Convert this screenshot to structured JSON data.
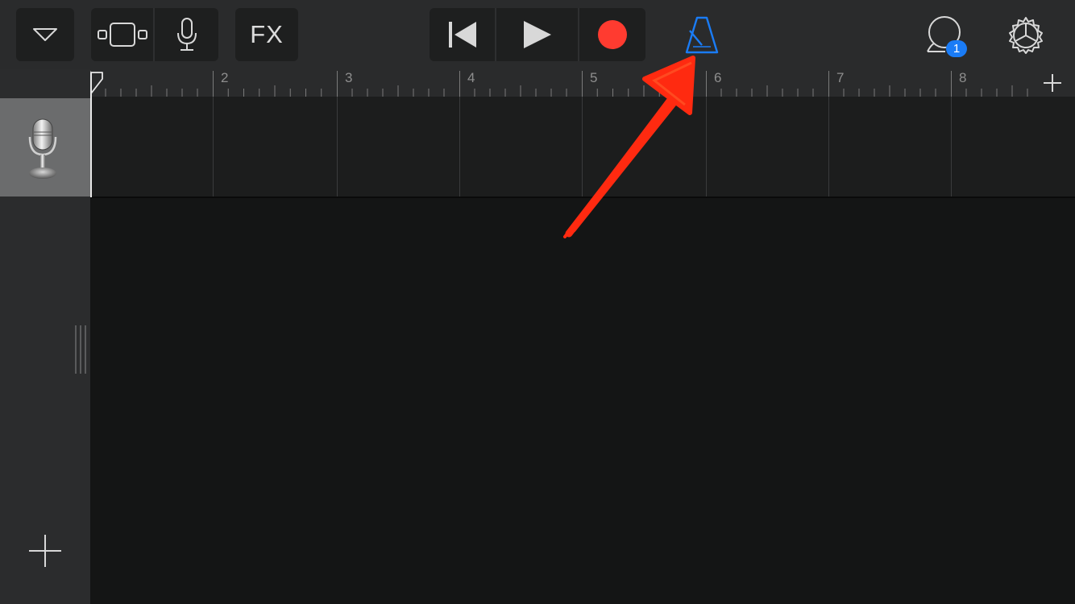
{
  "toolbar": {
    "fx_label": "FX",
    "buttons": {
      "track_menu": "chevron-down-icon",
      "browser": "track-view-icon",
      "instrument": "microphone-icon",
      "rewind": "go-to-beginning-icon",
      "play": "play-icon",
      "record": "record-icon",
      "metronome": "metronome-icon",
      "loops": "loop-browser-icon",
      "settings": "gear-icon"
    },
    "loops_badge": "1",
    "colors": {
      "record": "#ff3b30",
      "metronome_active": "#1a7cf6",
      "badge": "#1a7cf6"
    }
  },
  "ruler": {
    "bars": [
      "2",
      "3",
      "4",
      "5",
      "6",
      "7",
      "8"
    ]
  },
  "tracks": [
    {
      "instrument": "microphone-icon"
    }
  ],
  "annotation": {
    "type": "red-arrow",
    "color": "#ff2a10",
    "points_to": "metronome-button"
  }
}
